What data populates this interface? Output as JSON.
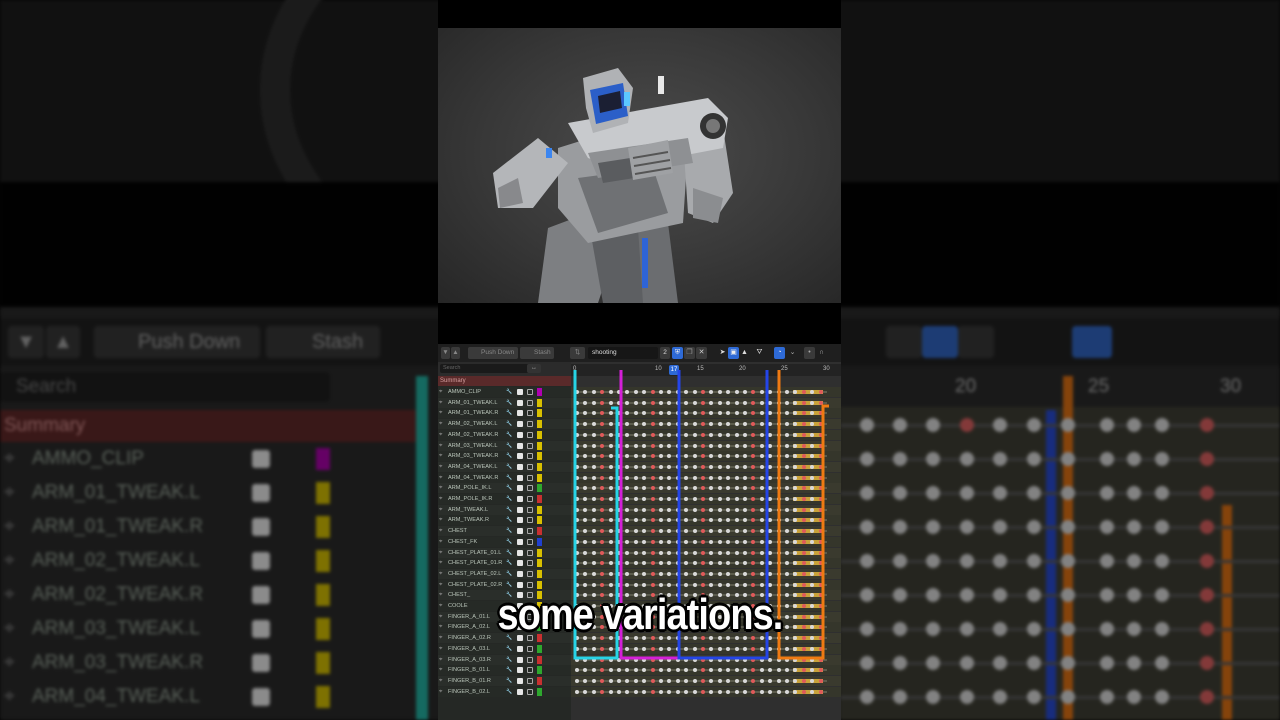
{
  "background": {
    "push_down_label": "Push Down",
    "stash_label": "Stash",
    "search_placeholder": "Search",
    "summary_label": "Summary",
    "rows": [
      "AMMO_CLIP",
      "ARM_01_TWEAK.L",
      "ARM_01_TWEAK.R",
      "ARM_02_TWEAK.L",
      "ARM_02_TWEAK.R",
      "ARM_03_TWEAK.L",
      "ARM_03_TWEAK.R",
      "ARM_04_TWEAK.L"
    ],
    "frame_numbers": [
      "20",
      "25",
      "30"
    ]
  },
  "dopesheet": {
    "push_down_label": "Push Down",
    "stash_label": "Stash",
    "action_name": "shooting",
    "users_count": "2",
    "search_placeholder": "Search",
    "summary_label": "Summary",
    "current_frame": "17",
    "ruler": [
      "0",
      "10",
      "15",
      "20",
      "25",
      "30"
    ],
    "channels": [
      "AMMO_CLIP",
      "ARM_01_TWEAK.L",
      "ARM_01_TWEAK.R",
      "ARM_02_TWEAK.L",
      "ARM_02_TWEAK.R",
      "ARM_03_TWEAK.L",
      "ARM_03_TWEAK.R",
      "ARM_04_TWEAK.L",
      "ARM_04_TWEAK.R",
      "ARM_POLE_IK.L",
      "ARM_POLE_IK.R",
      "ARM_TWEAK.L",
      "ARM_TWEAK.R",
      "CHEST",
      "CHEST_FK",
      "CHEST_PLATE_01.L",
      "CHEST_PLATE_01.R",
      "CHEST_PLATE_02.L",
      "CHEST_PLATE_02.R",
      "CHEST_",
      "COOLE",
      "FINGER_A_01.L",
      "FINGER_A_02.L",
      "FINGER_A_02.R",
      "FINGER_A_03.L",
      "FINGER_A_03.R",
      "FINGER_B_01.L",
      "FINGER_B_01.R",
      "FINGER_B_02.L"
    ],
    "swatch_colors": [
      "#b000b0",
      "#d8c000",
      "#d8c000",
      "#d8c000",
      "#d8c000",
      "#d8c000",
      "#d8c000",
      "#d8c000",
      "#d8c000",
      "#2ea82e",
      "#c83030",
      "#d8c000",
      "#d8c000",
      "#c83030",
      "#2040d0",
      "#d8c000",
      "#d8c000",
      "#d8c000",
      "#d8c000",
      "#d8c000",
      "#d8c000",
      "#c83030",
      "#2ea82e",
      "#c83030",
      "#2ea82e",
      "#c83030",
      "#2ea82e",
      "#c83030",
      "#2ea82e"
    ]
  },
  "subtitle": "some variations.",
  "colors": {
    "cyan_marker": "#27d4e6",
    "magenta_marker": "#d41fd8",
    "blue_marker": "#2445e8",
    "orange_marker": "#ef7a12",
    "keyframe": "#d9d9d9",
    "keyframe_red": "#e05a5a"
  }
}
